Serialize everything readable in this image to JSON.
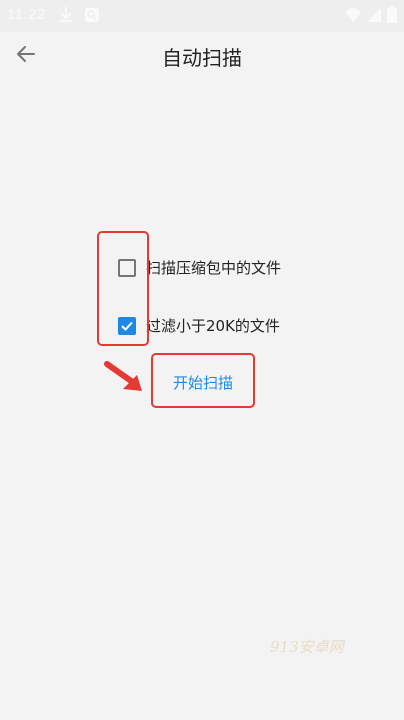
{
  "status_bar": {
    "time": "11:22",
    "icons": [
      "download-icon",
      "search-icon",
      "wifi-icon",
      "cellular-icon",
      "battery-icon"
    ]
  },
  "app_bar": {
    "back_icon": "arrow-left-icon",
    "title": "自动扫描"
  },
  "options": [
    {
      "label": "扫描压缩包中的文件",
      "checked": false
    },
    {
      "label": "过滤小于20K的文件",
      "checked": true
    }
  ],
  "start_button": {
    "label": "开始扫描"
  },
  "watermark": "913安卓网",
  "colors": {
    "accent": "#1e88e5",
    "highlight": "#e53935",
    "background": "#f3f3f3"
  }
}
